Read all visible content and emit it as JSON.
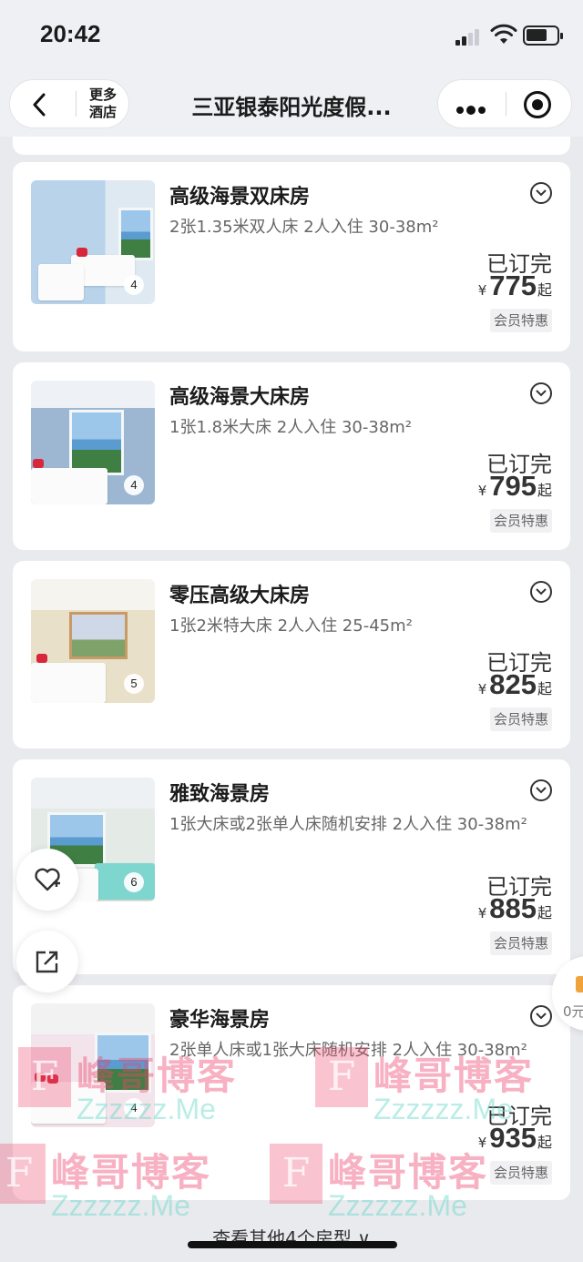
{
  "status_bar": {
    "time": "20:42"
  },
  "nav": {
    "more_hotels": "更多\n酒店",
    "title": "三亚银泰阳光度假..."
  },
  "rooms": [
    {
      "name": "高级海景双床房",
      "desc": "2张1.35米双人床 2人入住 30-38m²",
      "photo_count": "4",
      "status": "已订完",
      "currency": "¥",
      "price": "775",
      "suffix": "起",
      "tag": "会员特惠"
    },
    {
      "name": "高级海景大床房",
      "desc": "1张1.8米大床 2人入住 30-38m²",
      "photo_count": "4",
      "status": "已订完",
      "currency": "¥",
      "price": "795",
      "suffix": "起",
      "tag": "会员特惠"
    },
    {
      "name": "零压高级大床房",
      "desc": "1张2米特大床 2人入住 25-45m²",
      "photo_count": "5",
      "status": "已订完",
      "currency": "¥",
      "price": "825",
      "suffix": "起",
      "tag": "会员特惠"
    },
    {
      "name": "雅致海景房",
      "desc": "1张大床或2张单人床随机安排 2人入住 30-38m²",
      "photo_count": "6",
      "status": "已订完",
      "currency": "¥",
      "price": "885",
      "suffix": "起",
      "tag": "会员特惠"
    },
    {
      "name": "豪华海景房",
      "desc": "2张单人床或1张大床随机安排 2人入住 30-38m²",
      "photo_count": "4",
      "status": "已订完",
      "currency": "¥",
      "price": "935",
      "suffix": "起",
      "tag": "会员特惠"
    }
  ],
  "side_tab": {
    "text": "0元"
  },
  "watermark": {
    "logo": "F",
    "cn": "峰哥博客",
    "en": "Zzzzzz.Me"
  },
  "footer": {
    "more_types": "查看其他4个房型 ∨"
  },
  "colors": {
    "background": "#e9eaee",
    "card": "#ffffff",
    "watermark_pink": "#ec466e",
    "watermark_teal": "#64d7c8"
  }
}
